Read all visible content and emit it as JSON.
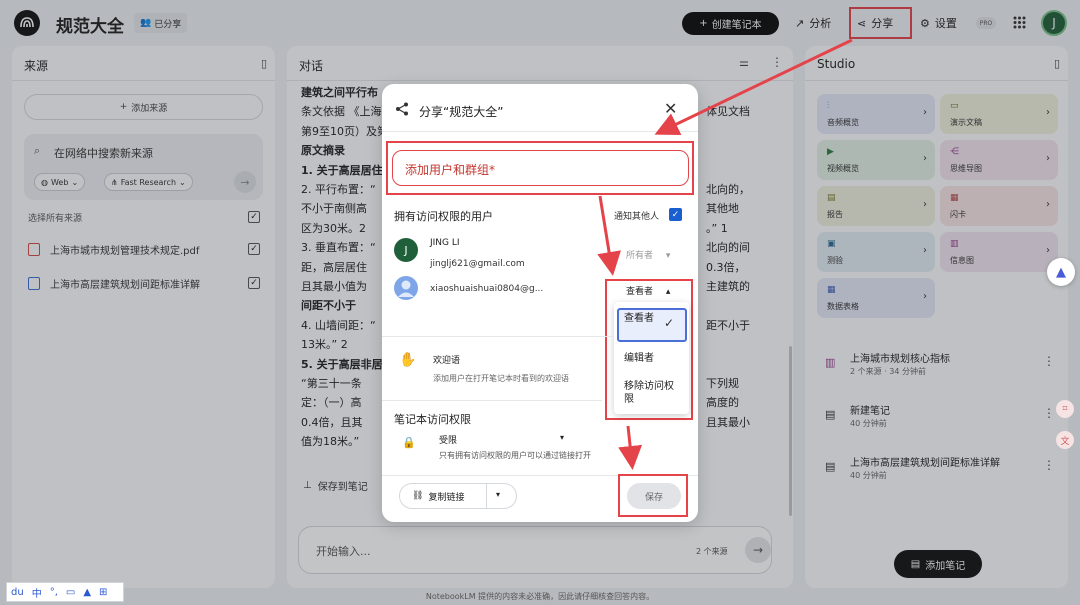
{
  "topbar": {
    "notebook_title": "规范大全",
    "shared_chip": "已分享",
    "create_notebook": "创建笔记本",
    "analytics": "分析",
    "share": "分享",
    "settings": "设置",
    "pro_badge": "PRO",
    "avatar_letter": "J"
  },
  "sources": {
    "title": "来源",
    "add_source": "添加来源",
    "search_placeholder": "在网络中搜索新来源",
    "web_chip": "Web",
    "research_chip": "Fast Research",
    "select_all": "选择所有来源",
    "items": [
      {
        "name": "上海市城市规划管理技术规定.pdf"
      },
      {
        "name": "上海市高层建筑规划间距标准详解"
      }
    ]
  },
  "chat": {
    "title": "对话",
    "lines": [
      {
        "text": "建筑之间平行布"
      },
      {
        "text": "条文依据 《上海",
        "right": "体见文档"
      },
      {
        "text": "第9至10页）及第"
      },
      {
        "text": "原文摘录"
      },
      {
        "text": "1. 关于高层居住"
      },
      {
        "text": "2. 平行布置：“",
        "right": "北向的，"
      },
      {
        "text": "不小于南侧高",
        "right": "其他地"
      },
      {
        "text": "区为30米。2",
        "right": "。” 1"
      },
      {
        "text": "3. 垂直布置：“",
        "right": "北向的间"
      },
      {
        "text": "距，高层居住",
        "right": "0.3倍，"
      },
      {
        "text": "且其最小值为",
        "right": "主建筑的"
      },
      {
        "text": "间距不小于"
      },
      {
        "text": "4. 山墙间距：“",
        "right": "距不小于"
      },
      {
        "text": "13米。” 2"
      },
      {
        "text": "5. 关于高层非居"
      },
      {
        "text": "“第三十一条",
        "right": "下列规"
      },
      {
        "text": "定：（一）高",
        "right": "高度的"
      },
      {
        "text": "0.4倍，且其",
        "right": "且其最小"
      },
      {
        "text": "值为18米。”"
      }
    ],
    "save_to_note": "保存到笔记",
    "input_placeholder": "开始输入...",
    "source_count": "2 个来源"
  },
  "studio": {
    "title": "Studio",
    "tiles": [
      {
        "label": "音频概览",
        "color": "#e3e7f5",
        "icon_color": "#3b5bb5"
      },
      {
        "label": "演示文稿",
        "color": "#eef0dc",
        "icon_color": "#6a6a2a"
      },
      {
        "label": "视频概览",
        "color": "#e1efe3",
        "icon_color": "#2f7a43"
      },
      {
        "label": "思维导图",
        "color": "#f1e4ef",
        "icon_color": "#9a3f8d"
      },
      {
        "label": "报告",
        "color": "#eeeedd",
        "icon_color": "#7a7a30"
      },
      {
        "label": "闪卡",
        "color": "#f5e3e3",
        "icon_color": "#b34545"
      },
      {
        "label": "测验",
        "color": "#e1ecf3",
        "icon_color": "#2f6a93"
      },
      {
        "label": "信息图",
        "color": "#f0e3ef",
        "icon_color": "#96408c"
      },
      {
        "label": "数据表格",
        "color": "#e4e8f5",
        "icon_color": "#3b5bb5"
      }
    ],
    "notes": [
      {
        "title": "上海城市规划核心指标",
        "meta": "2 个来源 · 34 分钟前"
      },
      {
        "title": "新建笔记",
        "meta": "40 分钟前"
      },
      {
        "title": "上海市高层建筑规划间距标准详解",
        "meta": "40 分钟前"
      }
    ],
    "add_note": "添加笔记"
  },
  "share_dialog": {
    "title": "分享“规范大全”",
    "add_users_placeholder": "添加用户和群组*",
    "access_heading": "拥有访问权限的用户",
    "notify_label": "通知其他人",
    "users": [
      {
        "name": "JING LI",
        "email": "jinglj621@gmail.com",
        "role": "所有者",
        "avatar_letter": "J"
      },
      {
        "name": "",
        "email": "xiaoshuaishuai0804@g...",
        "role": "查看者",
        "avatar_letter": ""
      }
    ],
    "role_options": [
      "查看者",
      "编辑者",
      "移除访问权限"
    ],
    "welcome_title": "欢迎语",
    "welcome_desc": "添加用户在打开笔记本时看到的欢迎语",
    "notebook_access_heading": "笔记本访问权限",
    "access_level": "受限",
    "access_desc": "只有拥有访问权限的用户可以通过链接打开",
    "copy_link": "复制链接",
    "save": "保存"
  },
  "footer": {
    "disclaimer": "NotebookLM 提供的内容未必准确，因此请仔细核查回答内容。"
  },
  "ime": {
    "mode": "中"
  },
  "colors": {
    "highlight_red": "#e5434a",
    "accent_blue": "#1a5fd0"
  }
}
